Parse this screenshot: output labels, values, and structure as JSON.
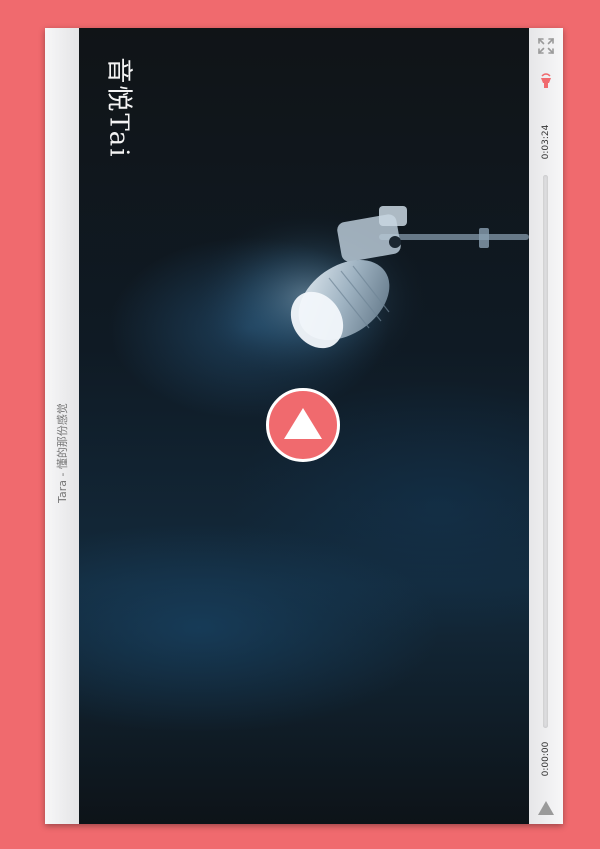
{
  "player": {
    "song_title": "Tara - 懂的那份感觉",
    "watermark_text": "音悦Tai",
    "duration": "0:03:24",
    "current_time": "0:00:00",
    "progress": 0
  },
  "icons": {
    "fullscreen": "fullscreen-icon",
    "volume": "volume-icon",
    "play_small": "play-icon",
    "play_big": "play-icon"
  },
  "colors": {
    "accent": "#f06a6e",
    "panel": "#ededee"
  }
}
